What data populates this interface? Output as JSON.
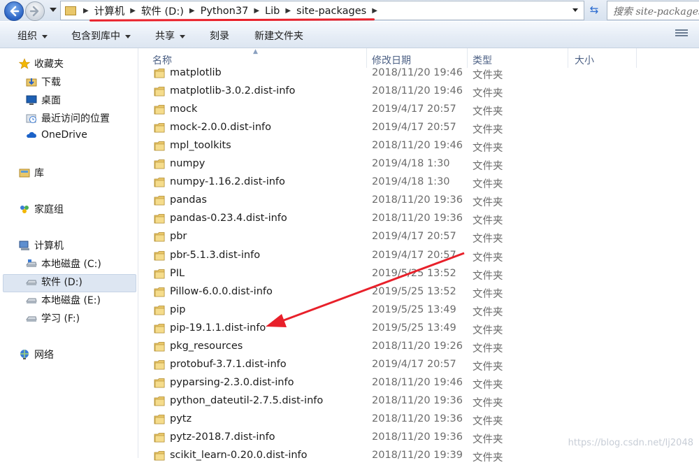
{
  "breadcrumb": [
    "计算机",
    "软件 (D:)",
    "Python37",
    "Lib",
    "site-packages"
  ],
  "search": {
    "placeholder": "搜索 site-packages"
  },
  "toolbar": {
    "organize": "组织",
    "include_in_library": "包含到库中",
    "share": "共享",
    "burn": "刻录",
    "new_folder": "新建文件夹"
  },
  "sidebar": {
    "favorites": "收藏夹",
    "favorites_items": [
      "下载",
      "桌面",
      "最近访问的位置",
      "OneDrive"
    ],
    "libraries": "库",
    "homegroup": "家庭组",
    "computer": "计算机",
    "drives": [
      "本地磁盘 (C:)",
      "软件 (D:)",
      "本地磁盘 (E:)",
      "学习 (F:)"
    ],
    "network": "网络"
  },
  "columns": {
    "name": "名称",
    "date": "修改日期",
    "type": "类型",
    "size": "大小"
  },
  "files": [
    {
      "name": "matplotlib",
      "date": "2018/11/20 19:46",
      "type": "文件夹"
    },
    {
      "name": "matplotlib-3.0.2.dist-info",
      "date": "2018/11/20 19:46",
      "type": "文件夹"
    },
    {
      "name": "mock",
      "date": "2019/4/17 20:57",
      "type": "文件夹"
    },
    {
      "name": "mock-2.0.0.dist-info",
      "date": "2019/4/17 20:57",
      "type": "文件夹"
    },
    {
      "name": "mpl_toolkits",
      "date": "2018/11/20 19:46",
      "type": "文件夹"
    },
    {
      "name": "numpy",
      "date": "2019/4/18 1:30",
      "type": "文件夹"
    },
    {
      "name": "numpy-1.16.2.dist-info",
      "date": "2019/4/18 1:30",
      "type": "文件夹"
    },
    {
      "name": "pandas",
      "date": "2018/11/20 19:36",
      "type": "文件夹"
    },
    {
      "name": "pandas-0.23.4.dist-info",
      "date": "2018/11/20 19:36",
      "type": "文件夹"
    },
    {
      "name": "pbr",
      "date": "2019/4/17 20:57",
      "type": "文件夹"
    },
    {
      "name": "pbr-5.1.3.dist-info",
      "date": "2019/4/17 20:57",
      "type": "文件夹"
    },
    {
      "name": "PIL",
      "date": "2019/5/25 13:52",
      "type": "文件夹"
    },
    {
      "name": "Pillow-6.0.0.dist-info",
      "date": "2019/5/25 13:52",
      "type": "文件夹"
    },
    {
      "name": "pip",
      "date": "2019/5/25 13:49",
      "type": "文件夹"
    },
    {
      "name": "pip-19.1.1.dist-info",
      "date": "2019/5/25 13:49",
      "type": "文件夹"
    },
    {
      "name": "pkg_resources",
      "date": "2018/11/20 19:26",
      "type": "文件夹"
    },
    {
      "name": "protobuf-3.7.1.dist-info",
      "date": "2019/4/17 20:57",
      "type": "文件夹"
    },
    {
      "name": "pyparsing-2.3.0.dist-info",
      "date": "2018/11/20 19:46",
      "type": "文件夹"
    },
    {
      "name": "python_dateutil-2.7.5.dist-info",
      "date": "2018/11/20 19:36",
      "type": "文件夹"
    },
    {
      "name": "pytz",
      "date": "2018/11/20 19:36",
      "type": "文件夹"
    },
    {
      "name": "pytz-2018.7.dist-info",
      "date": "2018/11/20 19:36",
      "type": "文件夹"
    },
    {
      "name": "scikit_learn-0.20.0.dist-info",
      "date": "2018/11/20 19:39",
      "type": "文件夹"
    }
  ],
  "watermark": "https://blog.csdn.net/lj2048",
  "colors": {
    "annotation_red": "#e8202a",
    "folder_yellow": "#e9c76a",
    "selection": "#dde6f2"
  }
}
